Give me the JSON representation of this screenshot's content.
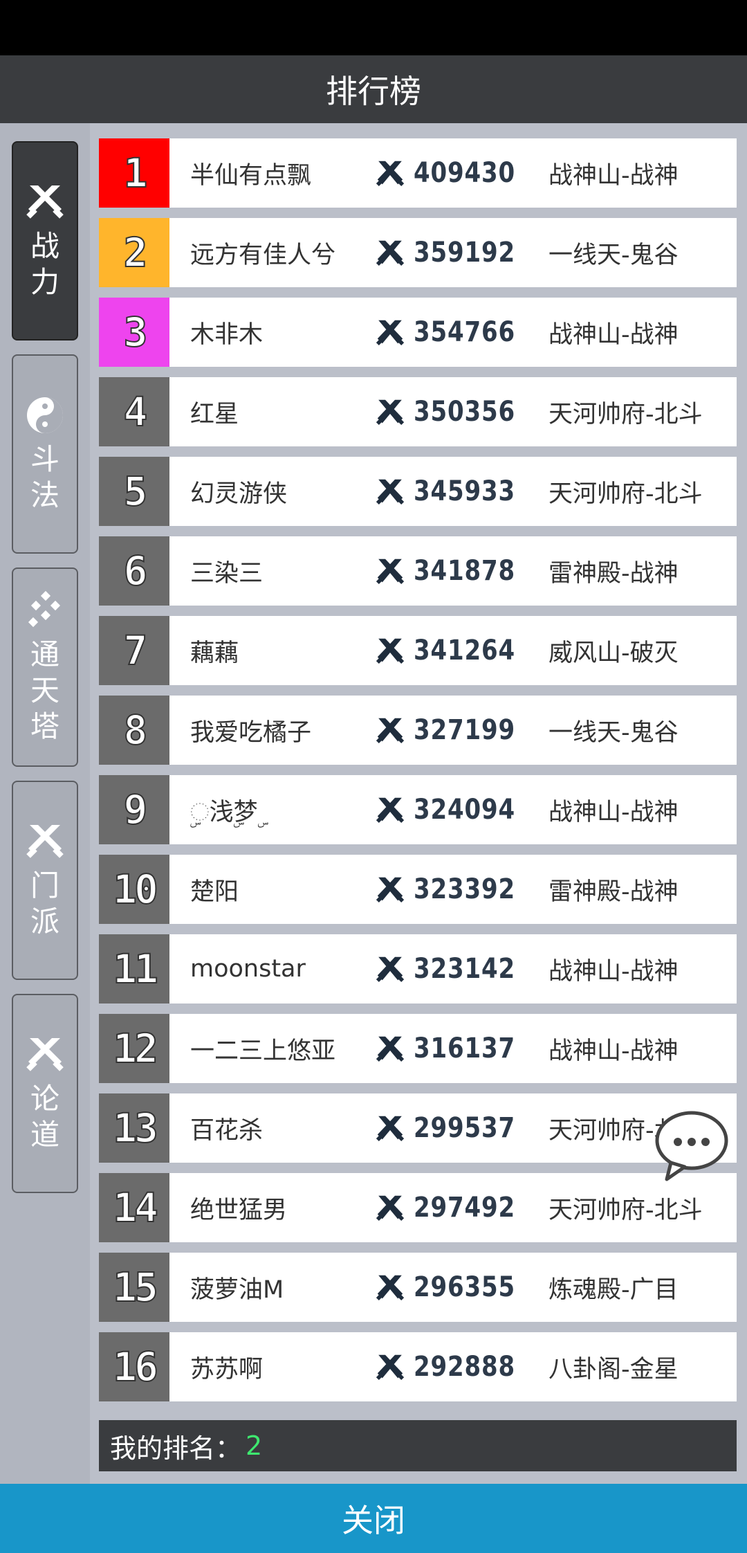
{
  "header": {
    "title": "排行榜"
  },
  "tabs": [
    {
      "label": "战力",
      "icon": "swords-icon",
      "active": true
    },
    {
      "label": "斗法",
      "icon": "yin-yang-icon",
      "active": false
    },
    {
      "label": "通天塔",
      "icon": "tower-icon",
      "active": false
    },
    {
      "label": "门派",
      "icon": "swords-icon",
      "active": false
    },
    {
      "label": "论道",
      "icon": "swords-icon",
      "active": false
    }
  ],
  "rows": [
    {
      "rank": "1",
      "name": "半仙有点飘",
      "power": "409430",
      "server": "战神山-战神",
      "color": "#ff0000"
    },
    {
      "rank": "2",
      "name": "远方有佳人兮",
      "power": "359192",
      "server": "一线天-鬼谷",
      "color": "#ffb52c"
    },
    {
      "rank": "3",
      "name": "木非木",
      "power": "354766",
      "server": "战神山-战神",
      "color": "#ee44ee"
    },
    {
      "rank": "4",
      "name": "红星",
      "power": "350356",
      "server": "天河帅府-北斗",
      "color": "#6b6b6b"
    },
    {
      "rank": "5",
      "name": "幻灵游侠",
      "power": "345933",
      "server": "天河帅府-北斗",
      "color": "#6b6b6b"
    },
    {
      "rank": "6",
      "name": "三染三",
      "power": "341878",
      "server": "雷神殿-战神",
      "color": "#6b6b6b"
    },
    {
      "rank": "7",
      "name": "藕藕",
      "power": "341264",
      "server": "威风山-破灭",
      "color": "#6b6b6b"
    },
    {
      "rank": "8",
      "name": "我爱吃橘子",
      "power": "327199",
      "server": "一线天-鬼谷",
      "color": "#6b6b6b"
    },
    {
      "rank": "9",
      "name": "◌ۣ浅ۣ梦ۣ",
      "power": "324094",
      "server": "战神山-战神",
      "color": "#6b6b6b"
    },
    {
      "rank": "10",
      "name": "楚阳",
      "power": "323392",
      "server": "雷神殿-战神",
      "color": "#6b6b6b"
    },
    {
      "rank": "11",
      "name": "moonstar",
      "power": "323142",
      "server": "战神山-战神",
      "color": "#6b6b6b"
    },
    {
      "rank": "12",
      "name": "一二三上悠亚",
      "power": "316137",
      "server": "战神山-战神",
      "color": "#6b6b6b"
    },
    {
      "rank": "13",
      "name": "百花杀",
      "power": "299537",
      "server": "天河帅府-北斗",
      "color": "#6b6b6b"
    },
    {
      "rank": "14",
      "name": "绝世猛男",
      "power": "297492",
      "server": "天河帅府-北斗",
      "color": "#6b6b6b"
    },
    {
      "rank": "15",
      "name": "菠萝油M",
      "power": "296355",
      "server": "炼魂殿-广目",
      "color": "#6b6b6b"
    },
    {
      "rank": "16",
      "name": "苏苏啊",
      "power": "292888",
      "server": "八卦阁-金星",
      "color": "#6b6b6b"
    }
  ],
  "my_rank": {
    "label": "我的排名：",
    "value": "2"
  },
  "footer": {
    "close_label": "关闭"
  }
}
